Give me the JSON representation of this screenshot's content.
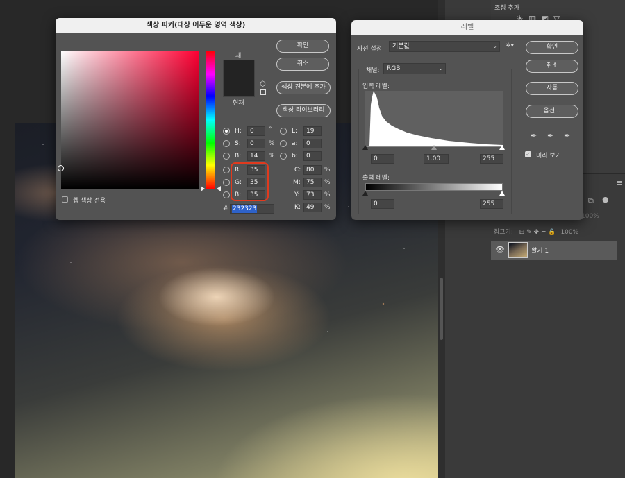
{
  "color_picker": {
    "title": "색상 피커(대상 어두운 영역 색상)",
    "buttons": {
      "ok": "확인",
      "cancel": "취소",
      "add_to_swatches": "색상 견본에 추가",
      "color_libraries": "색상 라이브러리"
    },
    "swatch": {
      "new_label": "새",
      "current_label": "현재",
      "color": "#232323"
    },
    "hsb": [
      {
        "label": "H:",
        "value": "0",
        "unit": "°",
        "selected": true
      },
      {
        "label": "S:",
        "value": "0",
        "unit": "%"
      },
      {
        "label": "B:",
        "value": "14",
        "unit": "%"
      }
    ],
    "rgb": [
      {
        "label": "R:",
        "value": "35"
      },
      {
        "label": "G:",
        "value": "35"
      },
      {
        "label": "B:",
        "value": "35"
      }
    ],
    "lab": [
      {
        "label": "L:",
        "value": "19"
      },
      {
        "label": "a:",
        "value": "0"
      },
      {
        "label": "b:",
        "value": "0"
      }
    ],
    "cmyk": [
      {
        "label": "C:",
        "value": "80",
        "unit": "%"
      },
      {
        "label": "M:",
        "value": "75",
        "unit": "%"
      },
      {
        "label": "Y:",
        "value": "73",
        "unit": "%"
      },
      {
        "label": "K:",
        "value": "49",
        "unit": "%"
      }
    ],
    "hex_prefix": "#",
    "hex": "232323",
    "websafe_label": "웹 색상 전용",
    "highlight_color": "#e03a1e"
  },
  "levels": {
    "title": "레벨",
    "preset_label": "사전 설정:",
    "preset_value": "기본값",
    "channel_label": "채널:",
    "channel_value": "RGB",
    "input_label": "입력 레벨:",
    "input_values": {
      "black": "0",
      "gamma": "1.00",
      "white": "255"
    },
    "output_label": "출력 레벨:",
    "output_values": {
      "black": "0",
      "white": "255"
    },
    "buttons": {
      "ok": "확인",
      "cancel": "취소",
      "auto": "자동",
      "options": "옵션..."
    },
    "preview_label": "미리 보기",
    "preview_checked": true
  },
  "adjustments": {
    "title": "조정 추가"
  },
  "layers": {
    "lock_label": "잠그기:",
    "opacity": "100%",
    "fill": "100%",
    "layer_name": "활기 1"
  }
}
